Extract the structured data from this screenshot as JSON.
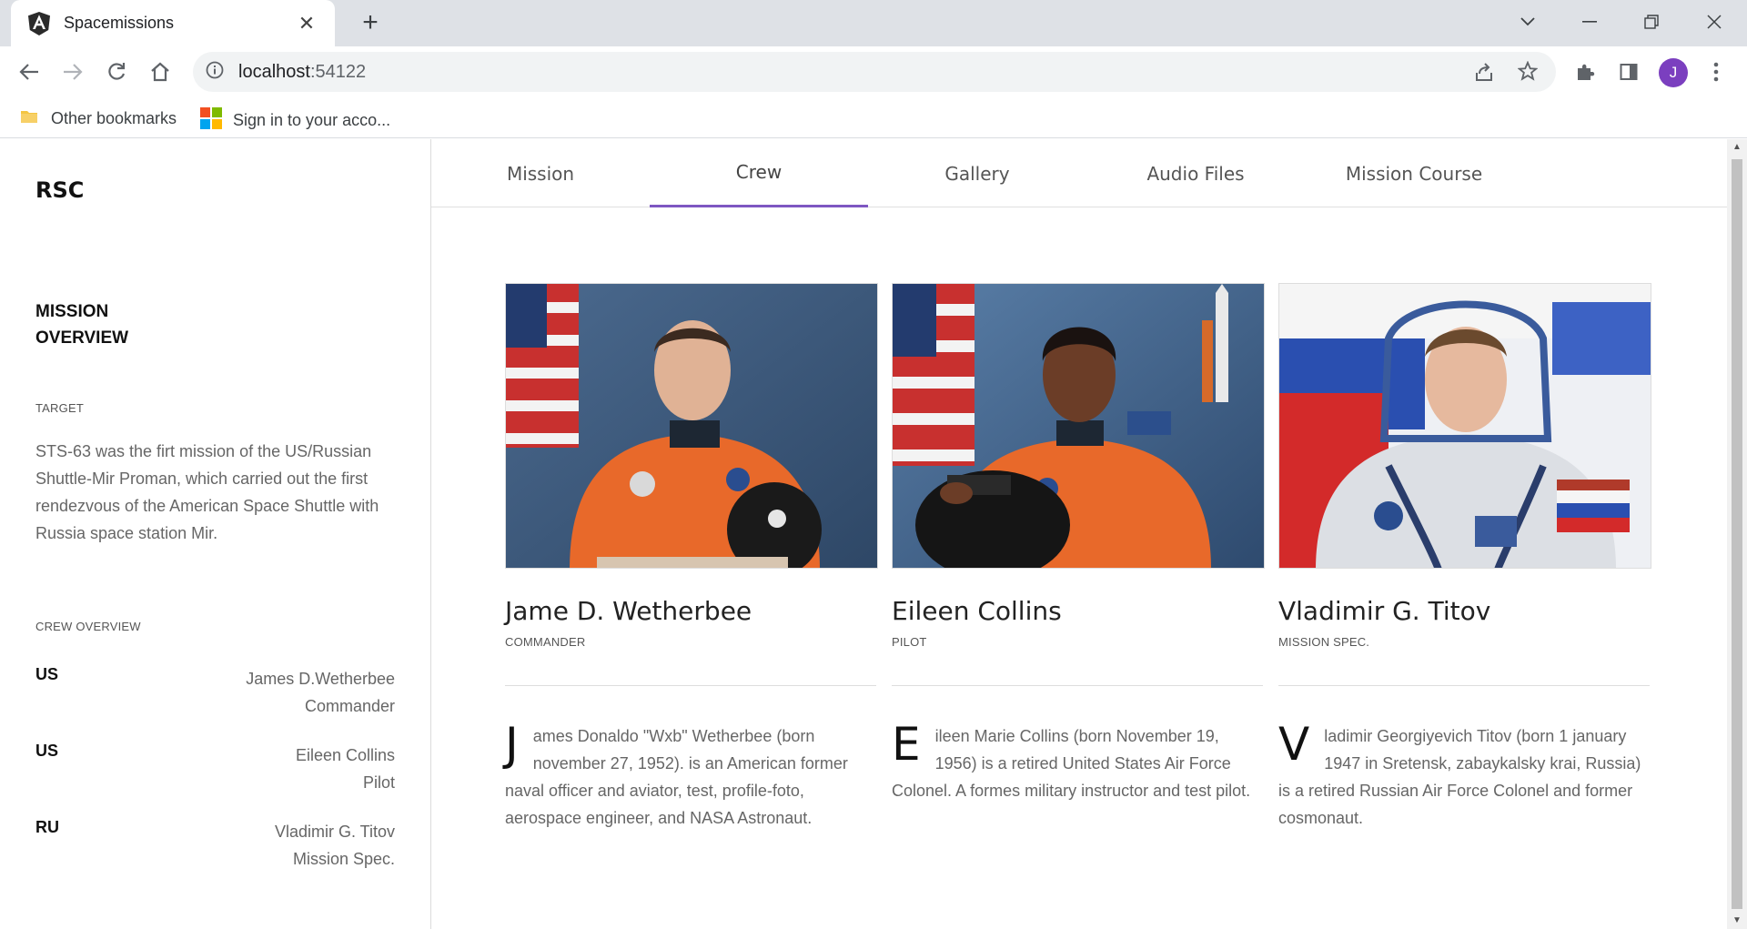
{
  "browser": {
    "tab_title": "Spacemissions",
    "url_host": "localhost",
    "url_port": ":54122",
    "profile_initial": "J",
    "bookmarks": [
      {
        "label": "Other bookmarks",
        "icon": "folder-icon"
      },
      {
        "label": "Sign in to your acco...",
        "icon": "microsoft-logo-icon"
      }
    ]
  },
  "sidebar": {
    "brand": "RSC",
    "mission_overview": "MISSION OVERVIEW",
    "target_caption": "TARGET",
    "target_text": "STS-63 was the firt mission of the US/Russian Shuttle-Mir Proman, which carried out the first rendezvous of the American Space Shuttle with Russia space station Mir.",
    "crew_caption": "CREW OVERVIEW",
    "crew": [
      {
        "country": "US",
        "name": "James D.Wetherbee",
        "role": "Commander"
      },
      {
        "country": "US",
        "name": "Eileen Collins",
        "role": "Pilot"
      },
      {
        "country": "RU",
        "name": "Vladimir G. Titov",
        "role": "Mission Spec."
      }
    ]
  },
  "tabs": [
    {
      "label": "Mission",
      "active": false
    },
    {
      "label": "Crew",
      "active": true
    },
    {
      "label": "Gallery",
      "active": false
    },
    {
      "label": "Audio Files",
      "active": false
    },
    {
      "label": "Mission Course",
      "active": false
    }
  ],
  "crew_cards": [
    {
      "name": "Jame D. Wetherbee",
      "role": "COMMANDER",
      "dropcap": "J",
      "bio": "ames Donaldo \"Wxb\" Wetherbee (born november 27, 1952). is an American former naval officer and aviator, test, profile-foto, aerospace engineer, and NASA Astronaut."
    },
    {
      "name": "Eileen Collins",
      "role": "PILOT",
      "dropcap": "E",
      "bio": "ileen Marie Collins (born November 19, 1956) is a retired United States Air Force Colonel. A formes military instructor and test pilot."
    },
    {
      "name": "Vladimir G. Titov",
      "role": "MISSION SPEC.",
      "dropcap": "V",
      "bio": "ladimir Georgiyevich Titov (born 1 january 1947 in Sretensk, zabaykalsky krai, Russia) is a retired Russian Air Force Colonel and former cosmonaut."
    }
  ],
  "colors": {
    "accent": "#7e57c2",
    "suit_orange": "#e8692a",
    "avatar": "#7b3fbf"
  }
}
